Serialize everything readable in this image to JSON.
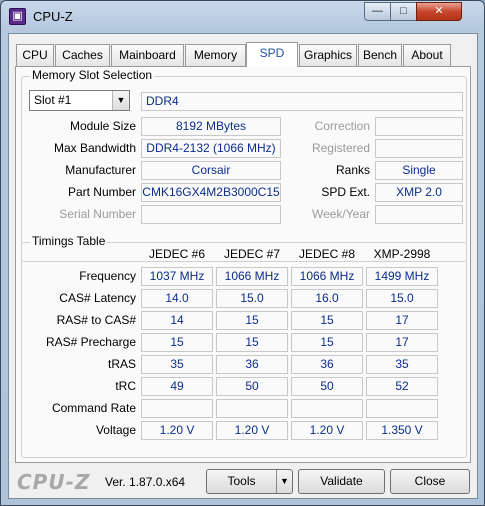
{
  "window": {
    "title": "CPU-Z",
    "minimize_glyph": "—",
    "maximize_glyph": "□",
    "close_glyph": "✕"
  },
  "tabs": [
    {
      "label": "CPU"
    },
    {
      "label": "Caches"
    },
    {
      "label": "Mainboard"
    },
    {
      "label": "Memory"
    },
    {
      "label": "SPD",
      "active": true
    },
    {
      "label": "Graphics"
    },
    {
      "label": "Bench"
    },
    {
      "label": "About"
    }
  ],
  "memory_slot": {
    "title": "Memory Slot Selection",
    "slot_selected": "Slot #1",
    "memory_type": "DDR4",
    "module_size_label": "Module Size",
    "module_size": "8192 MBytes",
    "max_bandwidth_label": "Max Bandwidth",
    "max_bandwidth": "DDR4-2132 (1066 MHz)",
    "manufacturer_label": "Manufacturer",
    "manufacturer": "Corsair",
    "part_number_label": "Part Number",
    "part_number": "CMK16GX4M2B3000C15",
    "serial_number_label": "Serial Number",
    "serial_number": "",
    "correction_label": "Correction",
    "correction": "",
    "registered_label": "Registered",
    "registered": "",
    "ranks_label": "Ranks",
    "ranks": "Single",
    "spd_ext_label": "SPD Ext.",
    "spd_ext": "XMP 2.0",
    "week_year_label": "Week/Year",
    "week_year": ""
  },
  "timings": {
    "title": "Timings Table",
    "columns": [
      "JEDEC #6",
      "JEDEC #7",
      "JEDEC #8",
      "XMP-2998"
    ],
    "rows": [
      {
        "label": "Frequency",
        "values": [
          "1037 MHz",
          "1066 MHz",
          "1066 MHz",
          "1499 MHz"
        ]
      },
      {
        "label": "CAS# Latency",
        "values": [
          "14.0",
          "15.0",
          "16.0",
          "15.0"
        ]
      },
      {
        "label": "RAS# to CAS#",
        "values": [
          "14",
          "15",
          "15",
          "17"
        ]
      },
      {
        "label": "RAS# Precharge",
        "values": [
          "15",
          "15",
          "15",
          "17"
        ]
      },
      {
        "label": "tRAS",
        "values": [
          "35",
          "36",
          "36",
          "35"
        ]
      },
      {
        "label": "tRC",
        "values": [
          "49",
          "50",
          "50",
          "52"
        ]
      },
      {
        "label": "Command Rate",
        "values": [
          "",
          "",
          "",
          ""
        ]
      },
      {
        "label": "Voltage",
        "values": [
          "1.20 V",
          "1.20 V",
          "1.20 V",
          "1.350 V"
        ]
      }
    ]
  },
  "footer": {
    "logo": "CPU-Z",
    "version": "Ver. 1.87.0.x64",
    "tools_label": "Tools",
    "validate_label": "Validate",
    "close_label": "Close"
  }
}
